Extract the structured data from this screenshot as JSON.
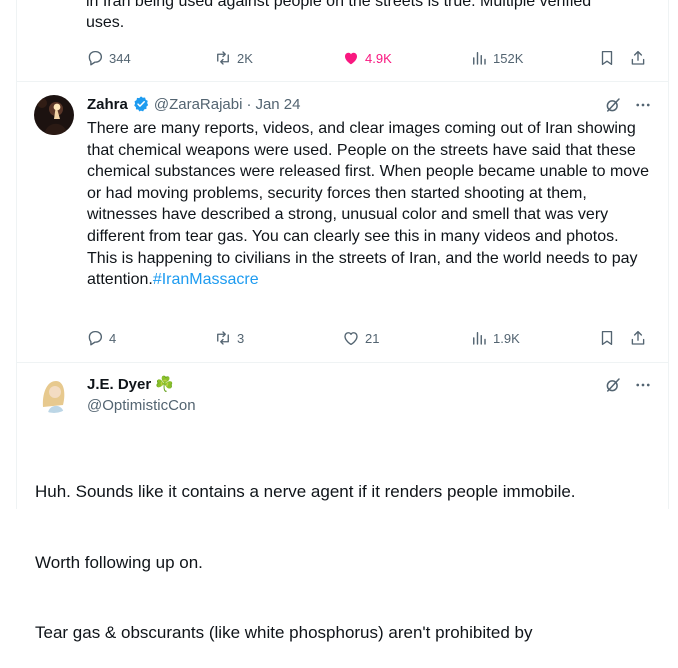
{
  "prev_tweet": {
    "text_cut": "in Iran being used against people on the streets is true. Multiple verified",
    "text_end": "uses.",
    "stats": {
      "replies": "344",
      "reposts": "2K",
      "likes": "4.9K",
      "views": "152K"
    }
  },
  "tweet_zahra": {
    "name": "Zahra",
    "handle": "@ZaraRajabi",
    "separator": "·",
    "date": "Jan 24",
    "body": "There are many reports, videos, and clear images coming out of Iran showing that chemical weapons were used. People on the streets have said that these chemical substances were released first. When people became unable to move or had moving problems, security forces then started shooting at them, witnesses have described a strong, unusual color and smell that was very different from tear gas. You can clearly see this in many videos and photos.\nThis is happening to civilians in the streets of Iran, and the world needs to pay attention.",
    "hashtag": "#IranMassacre",
    "stats": {
      "replies": "4",
      "reposts": "3",
      "likes": "21",
      "views": "1.9K"
    }
  },
  "tweet_dyer": {
    "name": "J.E. Dyer",
    "name_emoji": "☘️",
    "handle": "@OptimisticCon",
    "body_line1": "Huh. Sounds like it contains a nerve agent if it renders people immobile.",
    "body_line2": "Worth following up on.",
    "body_line3": "Tear gas & obscurants (like white phosphorus) aren't prohibited by"
  },
  "icons": {
    "reply": "reply-icon",
    "repost": "repost-icon",
    "like": "heart-icon",
    "views": "views-icon",
    "bookmark": "bookmark-icon",
    "share": "share-icon",
    "verified": "verified-badge-icon",
    "grok": "grok-icon",
    "more": "more-icon"
  },
  "colors": {
    "like_active": "#f91880",
    "link": "#1d9bf0",
    "verified": "#1d9bf0",
    "muted": "#536471",
    "shamrock": "#3aa655"
  }
}
